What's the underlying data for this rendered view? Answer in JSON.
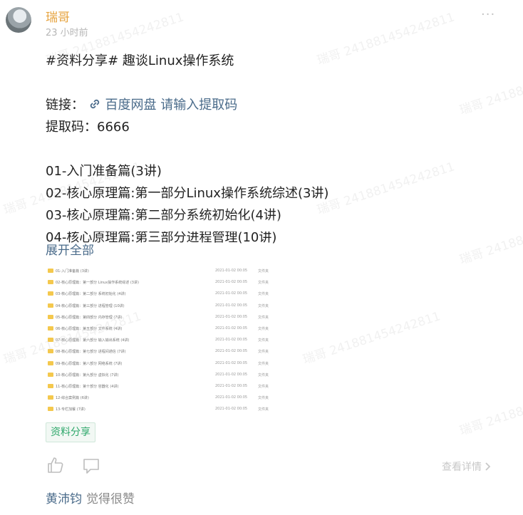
{
  "post": {
    "author": "瑞哥",
    "time": "23 小时前",
    "more_icon": "···",
    "title": "#资料分享# 趣谈Linux操作系统",
    "link_label": "链接：",
    "link_text": "百度网盘 请输入提取码",
    "code_line": "提取码：6666",
    "chapters": [
      "01-入门准备篇(3讲)",
      "02-核心原理篇:第一部分Linux操作系统综述(3讲)",
      "03-核心原理篇:第二部分系统初始化(4讲)",
      "04-核心原理篇:第三部分进程管理(10讲)"
    ],
    "expand": "展开全部",
    "tag": "资料分享",
    "detail": "查看详情",
    "likers": "黄沛钧",
    "likers_suffix": "觉得很赞",
    "watermark": "瑞哥 241881454242811"
  },
  "file_list": {
    "rows": [
      {
        "name": "01-入门准备篇 (3讲)",
        "date": "2021-01-02 00:05",
        "type": "文件夹"
      },
      {
        "name": "02-核心原理篇：第一部分 Linux操作系统综述 (3讲)",
        "date": "2021-01-02 00:05",
        "type": "文件夹"
      },
      {
        "name": "03-核心原理篇：第二部分 系统初始化 (4讲)",
        "date": "2021-01-02 00:05",
        "type": "文件夹"
      },
      {
        "name": "04-核心原理篇：第三部分 进程管理 (10讲)",
        "date": "2021-01-02 00:05",
        "type": "文件夹"
      },
      {
        "name": "05-核心原理篇：第四部分 内存管理 (7讲)",
        "date": "2021-01-02 00:05",
        "type": "文件夹"
      },
      {
        "name": "06-核心原理篇：第五部分 文件系统 (4讲)",
        "date": "2021-01-02 00:05",
        "type": "文件夹"
      },
      {
        "name": "07-核心原理篇：第六部分 输入输出系统 (4讲)",
        "date": "2021-01-02 00:05",
        "type": "文件夹"
      },
      {
        "name": "08-核心原理篇：第七部分 进程间通信 (7讲)",
        "date": "2021-01-02 00:05",
        "type": "文件夹"
      },
      {
        "name": "09-核心原理篇：第八部分 网络系统 (7讲)",
        "date": "2021-01-02 00:05",
        "type": "文件夹"
      },
      {
        "name": "10-核心原理篇：第九部分 虚拟化 (7讲)",
        "date": "2021-01-02 00:05",
        "type": "文件夹"
      },
      {
        "name": "11-核心原理篇：第十部分 容器化 (4讲)",
        "date": "2021-01-02 00:05",
        "type": "文件夹"
      },
      {
        "name": "12-综合案例篇 (6讲)",
        "date": "2021-01-02 00:05",
        "type": "文件夹"
      },
      {
        "name": "13-专栏加餐 (7讲)",
        "date": "2021-01-02 00:05",
        "type": "文件夹"
      }
    ]
  },
  "colors": {
    "author": "#e6a23c",
    "link": "#4a6b8a",
    "tag": "#2fa86b",
    "folder": "#f4c84d"
  },
  "icons": [
    "more-icon",
    "link-icon",
    "like-icon",
    "comment-icon",
    "chevron-right-icon",
    "folder-icon"
  ]
}
